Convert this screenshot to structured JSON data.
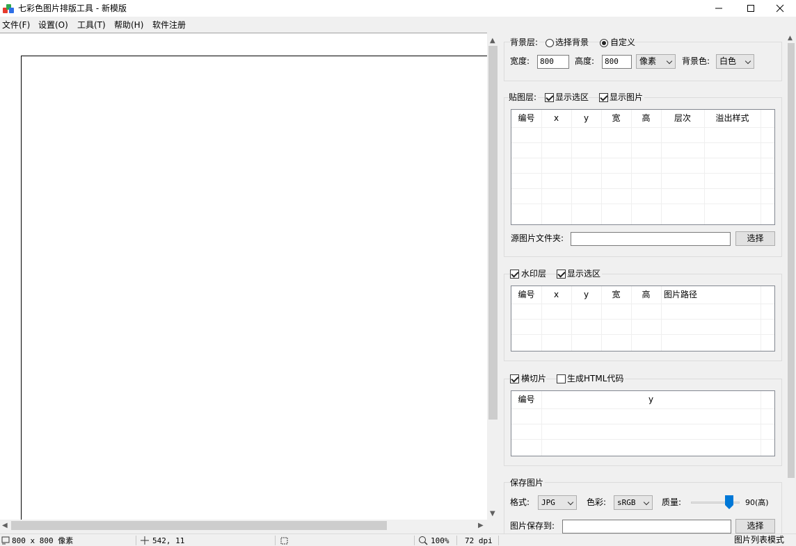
{
  "window": {
    "title": "七彩色图片排版工具 - 新模版",
    "icon": "app-logo-icon",
    "controls": [
      "minimize-icon",
      "maximize-icon",
      "close-icon"
    ]
  },
  "menu": [
    "文件(F)",
    "设置(O)",
    "工具(T)",
    "帮助(H)",
    "软件注册"
  ],
  "background_layer": {
    "label": "背景层:",
    "option_choose": "选择背景",
    "option_custom": "自定义",
    "selected": "自定义",
    "width_label": "宽度:",
    "width_value": "800",
    "height_label": "高度:",
    "height_value": "800",
    "unit": "像素",
    "bgcolor_label": "背景色:",
    "bgcolor": "白色"
  },
  "paste_layer": {
    "label": "贴图层:",
    "show_selection": "显示选区",
    "show_selection_checked": true,
    "show_image": "显示图片",
    "show_image_checked": true,
    "columns": [
      "编号",
      "x",
      "y",
      "宽",
      "高",
      "层次",
      "溢出样式"
    ],
    "rows": [],
    "source_folder_label": "源图片文件夹:",
    "source_folder_value": "",
    "choose_button": "选择"
  },
  "watermark_layer": {
    "label": "水印层",
    "checked": true,
    "show_selection": "显示选区",
    "show_selection_checked": true,
    "columns": [
      "编号",
      "x",
      "y",
      "宽",
      "高",
      "图片路径"
    ],
    "rows": []
  },
  "slice": {
    "label": "横切片",
    "checked": true,
    "gen_html": "生成HTML代码",
    "gen_html_checked": false,
    "columns": [
      "编号",
      "y"
    ],
    "rows": []
  },
  "save": {
    "label": "保存图片",
    "format_label": "格式:",
    "format": "JPG",
    "color_label": "色彩:",
    "color": "sRGB",
    "quality_label": "质量:",
    "quality_value": 90,
    "quality_text": "90(高)",
    "save_to_label": "图片保存到:",
    "save_to_value": "",
    "choose_button": "选择"
  },
  "status": {
    "size": "800 x 800 像素",
    "cursor": "542, 11",
    "selection": "",
    "zoom": "100%",
    "dpi": "72 dpi",
    "mode": "图片列表模式"
  },
  "colors": {
    "accent": "#0078d7",
    "window_bg": "#f0f0f0",
    "canvas_bg": "#ffffff"
  }
}
